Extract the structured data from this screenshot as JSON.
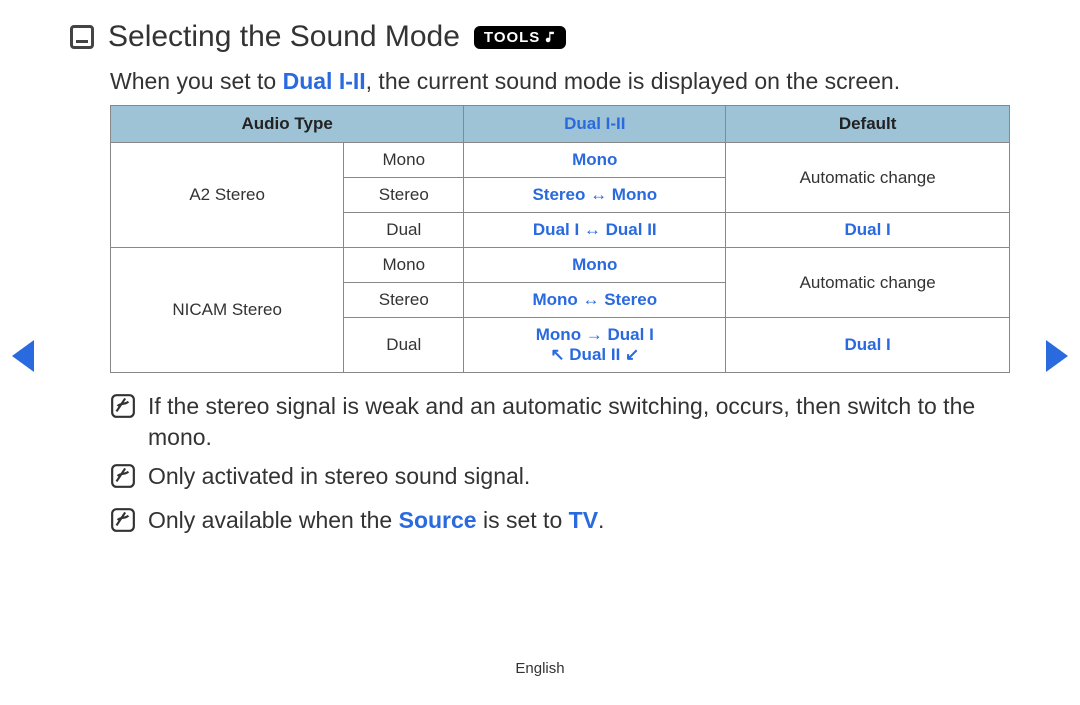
{
  "header": {
    "title": "Selecting the Sound Mode",
    "tools_label": "TOOLS"
  },
  "intro": {
    "pre": "When you set to ",
    "highlight": "Dual I-II",
    "post": ", the current sound mode is displayed on the screen."
  },
  "table": {
    "headers": {
      "col1": "Audio Type",
      "col2": "Dual I-II",
      "col3": "Default"
    },
    "groups": [
      {
        "name": "A2 Stereo",
        "rows": [
          {
            "audio": "Mono",
            "dual": "Mono",
            "default": "Automatic change",
            "default_rowspan": 2
          },
          {
            "audio": "Stereo",
            "dual": "Stereo ↔ Mono"
          },
          {
            "audio": "Dual",
            "dual": "Dual I ↔ Dual II",
            "default": "Dual I",
            "default_blue": true
          }
        ]
      },
      {
        "name": "NICAM Stereo",
        "rows": [
          {
            "audio": "Mono",
            "dual": "Mono",
            "default": "Automatic change",
            "default_rowspan": 2
          },
          {
            "audio": "Stereo",
            "dual": "Mono ↔ Stereo"
          },
          {
            "audio": "Dual",
            "dual_line1": "Mono → Dual I",
            "dual_line2": "↖ Dual II ↙",
            "default": "Dual I",
            "default_blue": true
          }
        ]
      }
    ]
  },
  "notes": [
    {
      "text": "If the stereo signal is weak and an automatic switching, occurs, then switch to the mono."
    },
    {
      "text": "Only activated in stereo sound signal."
    },
    {
      "pre": "Only available when the ",
      "hl1": "Source",
      "mid": " is set to ",
      "hl2": "TV",
      "post": "."
    }
  ],
  "footer": {
    "language": "English"
  }
}
